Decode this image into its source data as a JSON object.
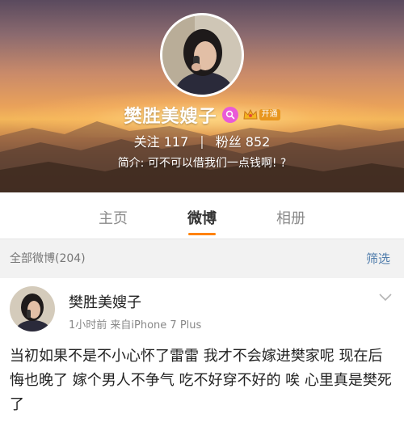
{
  "profile": {
    "name": "樊胜美嫂子",
    "vip_label": "开通",
    "following_label": "关注",
    "following_count": "117",
    "followers_label": "粉丝",
    "followers_count": "852",
    "stats_divider": "|",
    "bio": "简介: 可不可以借我们一点钱啊! ?"
  },
  "tabs": [
    {
      "label": "主页",
      "active": false
    },
    {
      "label": "微博",
      "active": true
    },
    {
      "label": "相册",
      "active": false
    }
  ],
  "filter": {
    "label": "全部微博(204)",
    "button": "筛选"
  },
  "post": {
    "author": "樊胜美嫂子",
    "meta": "1小时前  来自iPhone 7 Plus",
    "text": "当初如果不是不小心怀了雷雷 我才不会嫁进樊家呢 现在后悔也晚了 嫁个男人不争气 吃不好穿不好的 唉 心里真是樊死了"
  },
  "colors": {
    "accent": "#ff8200",
    "link": "#4f7cab",
    "vip": "#e8961e",
    "badge": "#e95ad8"
  }
}
